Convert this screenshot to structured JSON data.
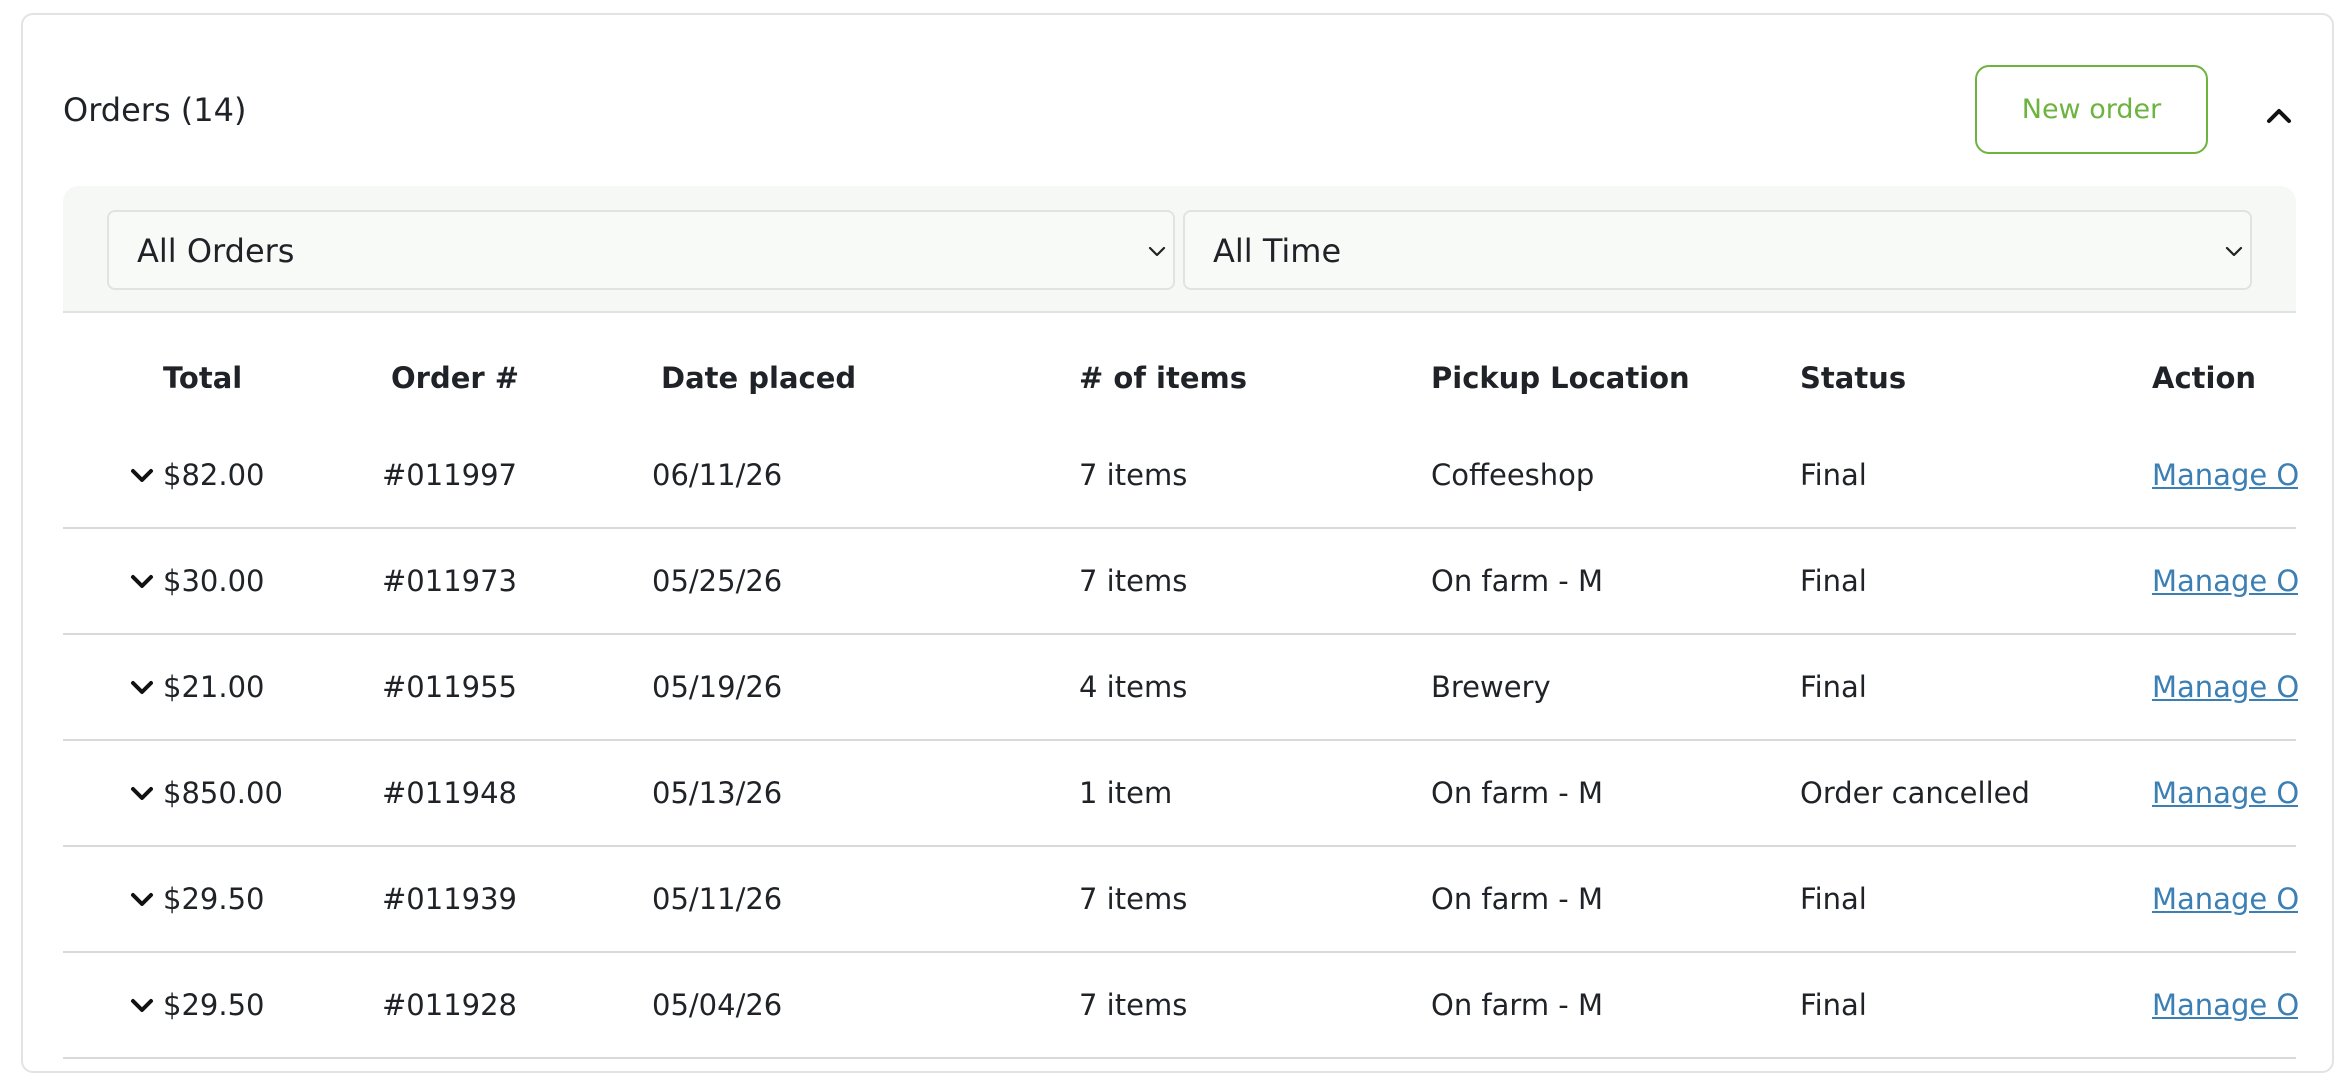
{
  "orders_panel": {
    "title": "Orders (14)",
    "new_order_label": "New order",
    "collapse_icon": "chevron-up-icon",
    "accent_color": "#6db33f",
    "link_color": "#3b7fb4"
  },
  "filters": {
    "order_filter": {
      "selected": "All Orders",
      "icon": "chevron-down-icon"
    },
    "time_filter": {
      "selected": "All Time",
      "icon": "chevron-down-icon"
    }
  },
  "table": {
    "columns": [
      "Total",
      "Order #",
      "Date placed",
      "# of items",
      "Pickup Location",
      "Status",
      "Action"
    ],
    "rows": [
      {
        "total": "$82.00",
        "order_no": "#011997",
        "date": "06/11/26",
        "items": "7 items",
        "location": "Coffeeshop",
        "status": "Final",
        "action": "Manage O"
      },
      {
        "total": "$30.00",
        "order_no": "#011973",
        "date": "05/25/26",
        "items": "7 items",
        "location": "On farm - M",
        "status": "Final",
        "action": "Manage O"
      },
      {
        "total": "$21.00",
        "order_no": "#011955",
        "date": "05/19/26",
        "items": "4 items",
        "location": "Brewery",
        "status": "Final",
        "action": "Manage O"
      },
      {
        "total": "$850.00",
        "order_no": "#011948",
        "date": "05/13/26",
        "items": "1 item",
        "location": "On farm - M",
        "status": "Order cancelled",
        "action": "Manage O"
      },
      {
        "total": "$29.50",
        "order_no": "#011939",
        "date": "05/11/26",
        "items": "7 items",
        "location": "On farm - M",
        "status": "Final",
        "action": "Manage O"
      },
      {
        "total": "$29.50",
        "order_no": "#011928",
        "date": "05/04/26",
        "items": "7 items",
        "location": "On farm - M",
        "status": "Final",
        "action": "Manage O"
      }
    ]
  }
}
